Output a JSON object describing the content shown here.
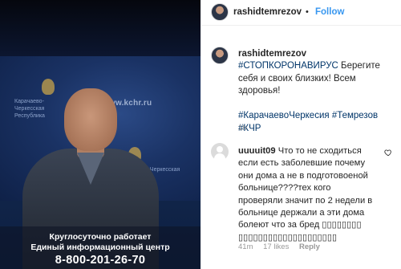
{
  "media": {
    "wall_org": "Карачаево-Черкесская Республика",
    "wall_org_right": "Карачаево-Черкесская Республика",
    "wall_url": "www.kchr.ru",
    "caption_line1": "Круглосуточно работает",
    "caption_line2": "Единый информационный центр",
    "caption_phone": "8-800-201-26-70"
  },
  "header": {
    "username": "rashidtemrezov",
    "separator": "•",
    "follow_label": "Follow"
  },
  "post": {
    "username": "rashidtemrezov",
    "hashtag_1": "#СТОПКОРОНАВИРУС",
    "text": " Берегите себя и своих близких! Всем здоровья!",
    "hashtag_2": "#КарачаевоЧеркесия",
    "hashtag_3": "#Темрезов",
    "hashtag_4": "#КЧР",
    "time": "1h"
  },
  "comment": {
    "username": "uuuuit09",
    "text": " Что то не сходиться если есть заболевшие почему они дома а не в подготовоеной больнице????тех кого проверяли значит по 2 недели в больнице держали а эти дома болеют что за бред ▯▯▯▯▯▯▯▯ ▯▯▯▯▯▯▯▯▯▯▯▯▯▯▯▯▯▯▯▯",
    "time": "41m",
    "likes": "17 likes",
    "reply_label": "Reply"
  },
  "colors": {
    "link_blue": "#3897f0",
    "hashtag": "#003569",
    "meta_gray": "#999999"
  }
}
